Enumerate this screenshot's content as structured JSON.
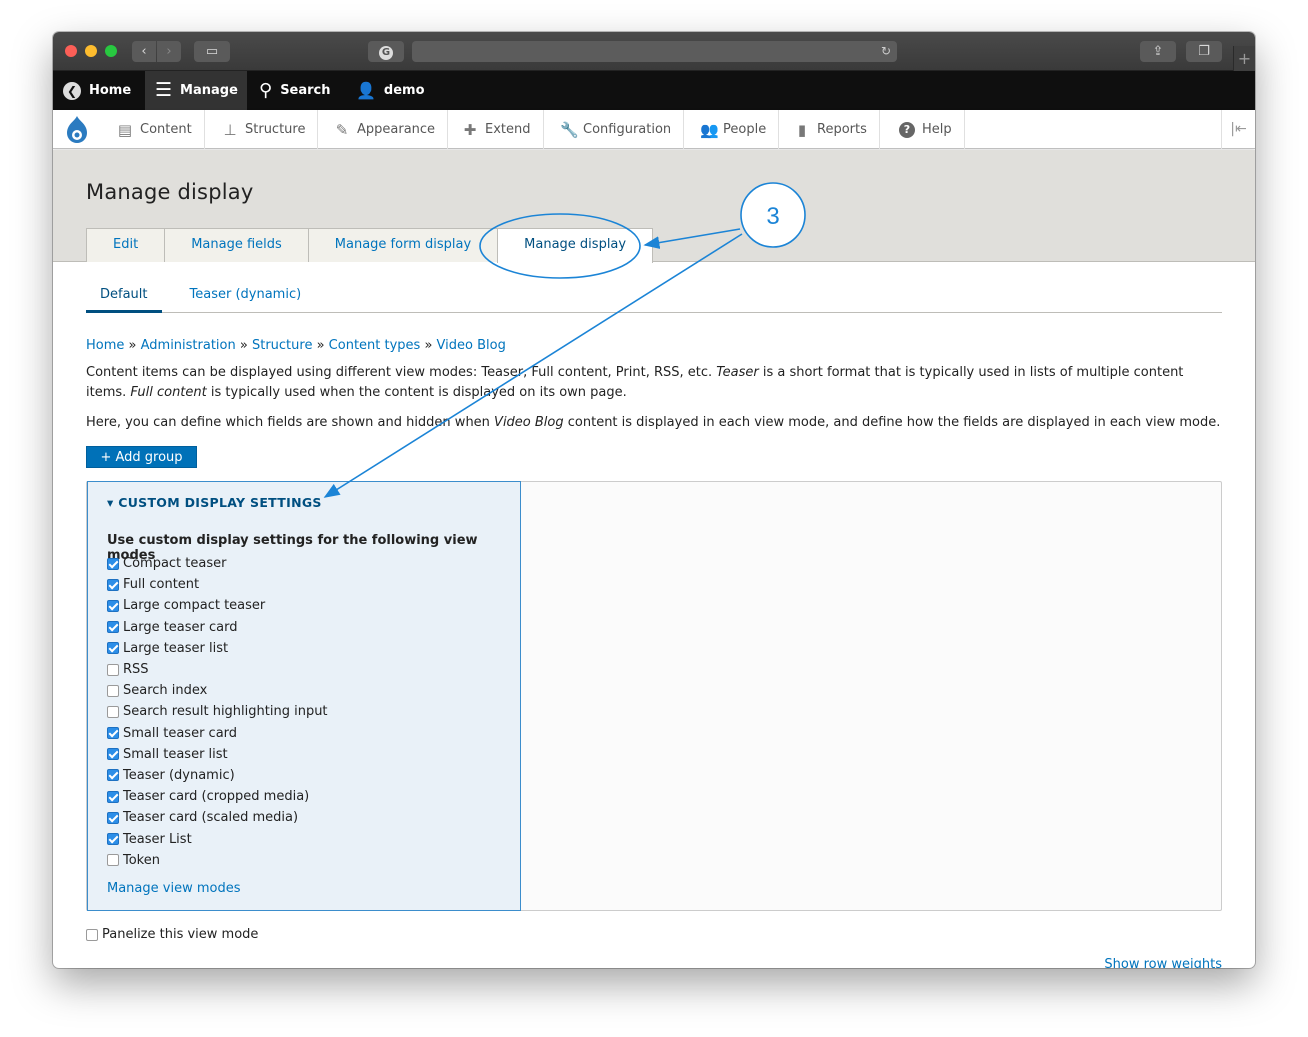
{
  "toolbar": {
    "home": "Home",
    "manage": "Manage",
    "search": "Search",
    "user": "demo"
  },
  "tray": {
    "items": [
      {
        "label": "Content",
        "icon": "document-icon"
      },
      {
        "label": "Structure",
        "icon": "sitemap-icon"
      },
      {
        "label": "Appearance",
        "icon": "paintbrush-icon"
      },
      {
        "label": "Extend",
        "icon": "puzzle-icon"
      },
      {
        "label": "Configuration",
        "icon": "wrench-icon"
      },
      {
        "label": "People",
        "icon": "people-icon"
      },
      {
        "label": "Reports",
        "icon": "bar-chart-icon"
      },
      {
        "label": "Help",
        "icon": "help-icon"
      }
    ]
  },
  "page": {
    "title": "Manage display",
    "primary_tabs": [
      "Edit",
      "Manage fields",
      "Manage form display",
      "Manage display"
    ],
    "secondary_tabs": [
      "Default",
      "Teaser (dynamic)"
    ],
    "breadcrumb": [
      "Home",
      "Administration",
      "Structure",
      "Content types",
      "Video Blog"
    ],
    "desc1_a": "Content items can be displayed using different view modes: Teaser, Full content, Print, RSS, etc. ",
    "desc1_b": "Teaser",
    "desc1_c": " is a short format that is typically used in lists of multiple content items. ",
    "desc1_d": "Full content",
    "desc1_e": " is typically used when the content is displayed on its own page.",
    "desc2_a": "Here, you can define which fields are shown and hidden when ",
    "desc2_b": "Video Blog",
    "desc2_c": " content is displayed in each view mode, and define how the fields are displayed in each view mode.",
    "add_group": "+ Add group"
  },
  "custom_settings": {
    "summary": "▾ CUSTOM DISPLAY SETTINGS",
    "legend": "Use custom display settings for the following view modes",
    "modes": [
      {
        "label": "Compact teaser",
        "checked": true
      },
      {
        "label": "Full content",
        "checked": true
      },
      {
        "label": "Large compact teaser",
        "checked": true
      },
      {
        "label": "Large teaser card",
        "checked": true
      },
      {
        "label": "Large teaser list",
        "checked": true
      },
      {
        "label": "RSS",
        "checked": false
      },
      {
        "label": "Search index",
        "checked": false
      },
      {
        "label": "Search result highlighting input",
        "checked": false
      },
      {
        "label": "Small teaser card",
        "checked": true
      },
      {
        "label": "Small teaser list",
        "checked": true
      },
      {
        "label": "Teaser (dynamic)",
        "checked": true
      },
      {
        "label": "Teaser card (cropped media)",
        "checked": true
      },
      {
        "label": "Teaser card (scaled media)",
        "checked": true
      },
      {
        "label": "Teaser List",
        "checked": true
      },
      {
        "label": "Token",
        "checked": false
      }
    ],
    "manage_link": "Manage view modes"
  },
  "panelize": "Panelize this view mode",
  "show_row_weights": "Show row weights",
  "annotation": {
    "number": "3",
    "color": "#1b84d6"
  }
}
